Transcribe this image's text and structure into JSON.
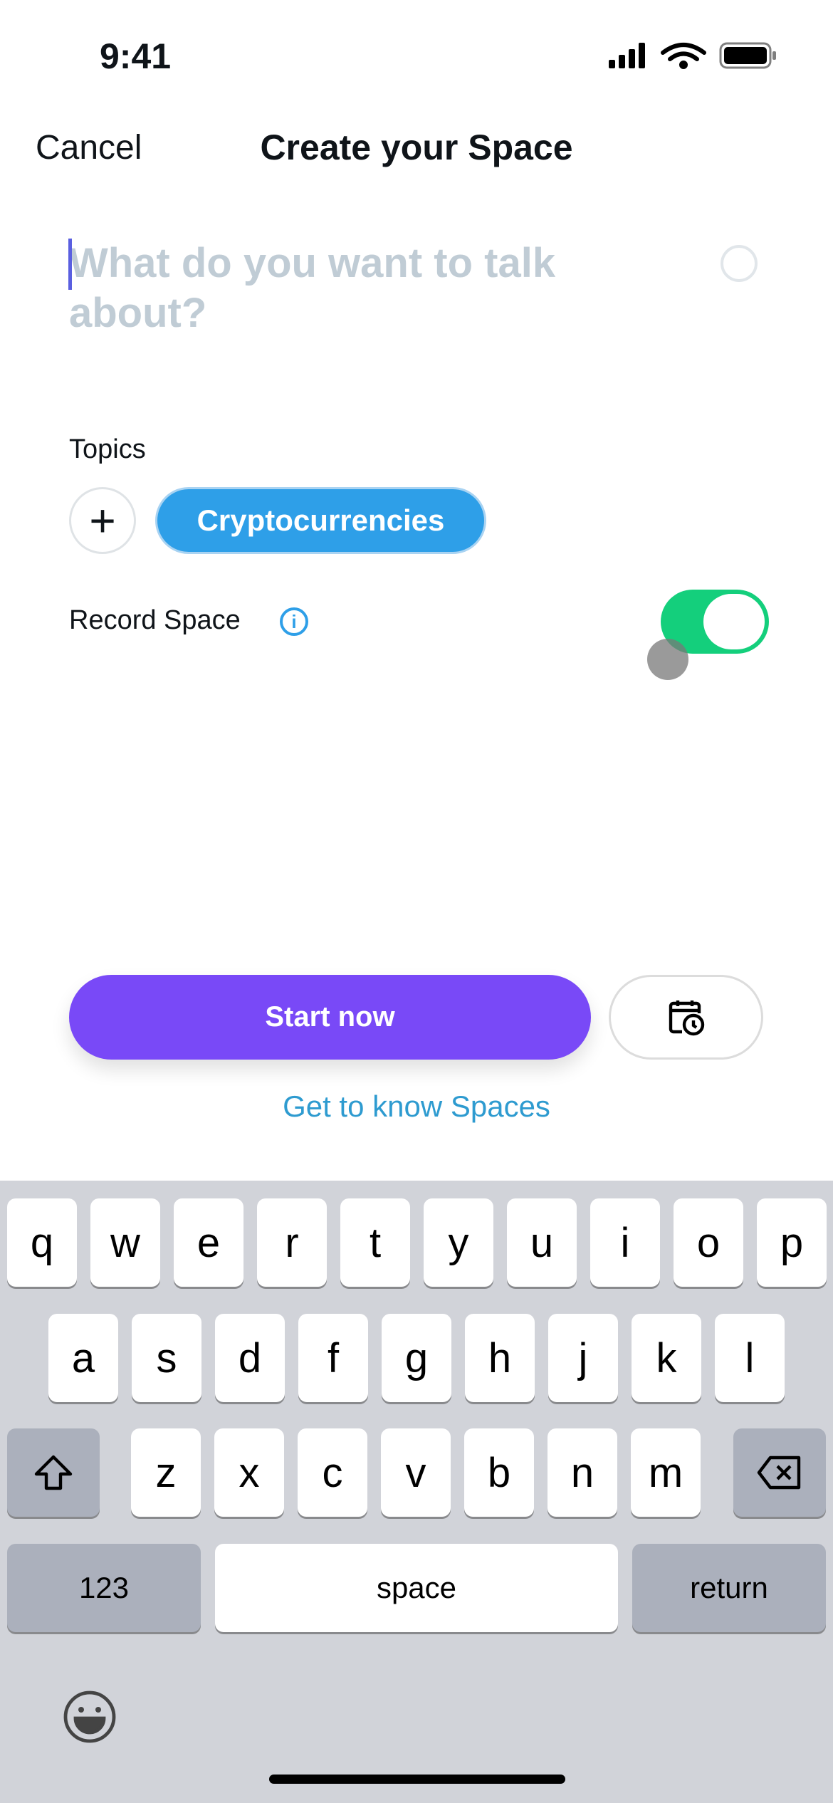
{
  "status_bar": {
    "time": "9:41"
  },
  "nav": {
    "cancel": "Cancel",
    "title": "Create your Space"
  },
  "input": {
    "placeholder": "What do you want to talk about?"
  },
  "topics": {
    "label": "Topics",
    "chips": [
      "Cryptocurrencies"
    ]
  },
  "record": {
    "label": "Record Space",
    "toggle_on": true,
    "toggle_color": "#14cf7c"
  },
  "actions": {
    "start": "Start now",
    "start_color": "#7949f7",
    "learn": "Get to know Spaces"
  },
  "keyboard": {
    "row1": [
      "q",
      "w",
      "e",
      "r",
      "t",
      "y",
      "u",
      "i",
      "o",
      "p"
    ],
    "row2": [
      "a",
      "s",
      "d",
      "f",
      "g",
      "h",
      "j",
      "k",
      "l"
    ],
    "row3": [
      "z",
      "x",
      "c",
      "v",
      "b",
      "n",
      "m"
    ],
    "numbers": "123",
    "space": "space",
    "return": "return"
  }
}
